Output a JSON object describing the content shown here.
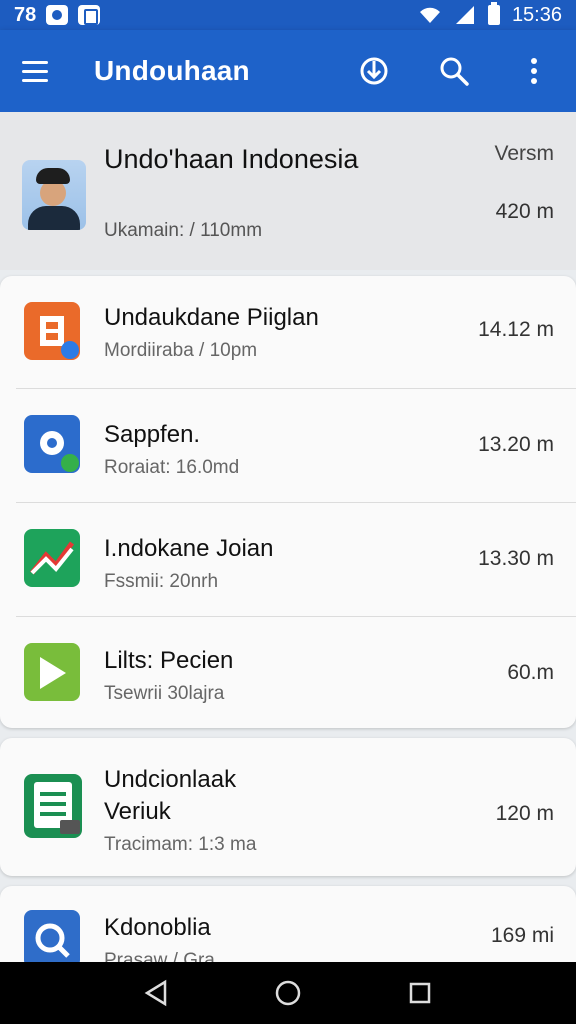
{
  "status_bar": {
    "left_time": "78",
    "time": "15:36"
  },
  "app_bar": {
    "title": "Undouhaan"
  },
  "header_app": {
    "title": "Undo'haan Indonesia",
    "subtitle": "Ukamain: / 110mm",
    "version_label": "Versm",
    "size": "420 m"
  },
  "cards": [
    {
      "items": [
        {
          "name": "Undaukdane Piiglan",
          "sub": "Mordiiraba / 10pm",
          "size": "14.12 m",
          "icon": "orange-b-app-icon"
        },
        {
          "name": "Sappfen.",
          "sub": "Roraiat: 16.0md",
          "size": "13.20 m",
          "icon": "blue-gear-app-icon"
        },
        {
          "name": "I.ndokane Joian",
          "sub": "Fssmii: 20nrh",
          "size": "13.30 m",
          "icon": "green-chart-app-icon"
        },
        {
          "name": "Lilts: Pecien",
          "sub": "Tsewrii 30lajra",
          "size": "60.m",
          "icon": "lime-play-app-icon"
        }
      ]
    },
    {
      "items": [
        {
          "name": "Undcionlaak Veriuk",
          "sub": "Tracimam: 1:3 ma",
          "size": "120 m",
          "icon": "sheet-app-icon"
        }
      ]
    },
    {
      "items": [
        {
          "name": "Kdonoblia",
          "sub": "Prasaw / Gra",
          "size": "169 mi",
          "icon": "doc-search-app-icon"
        }
      ]
    }
  ],
  "colors": {
    "primary": "#1e62c9",
    "status_bar": "#1d5cc0",
    "background": "#e9ecef"
  }
}
